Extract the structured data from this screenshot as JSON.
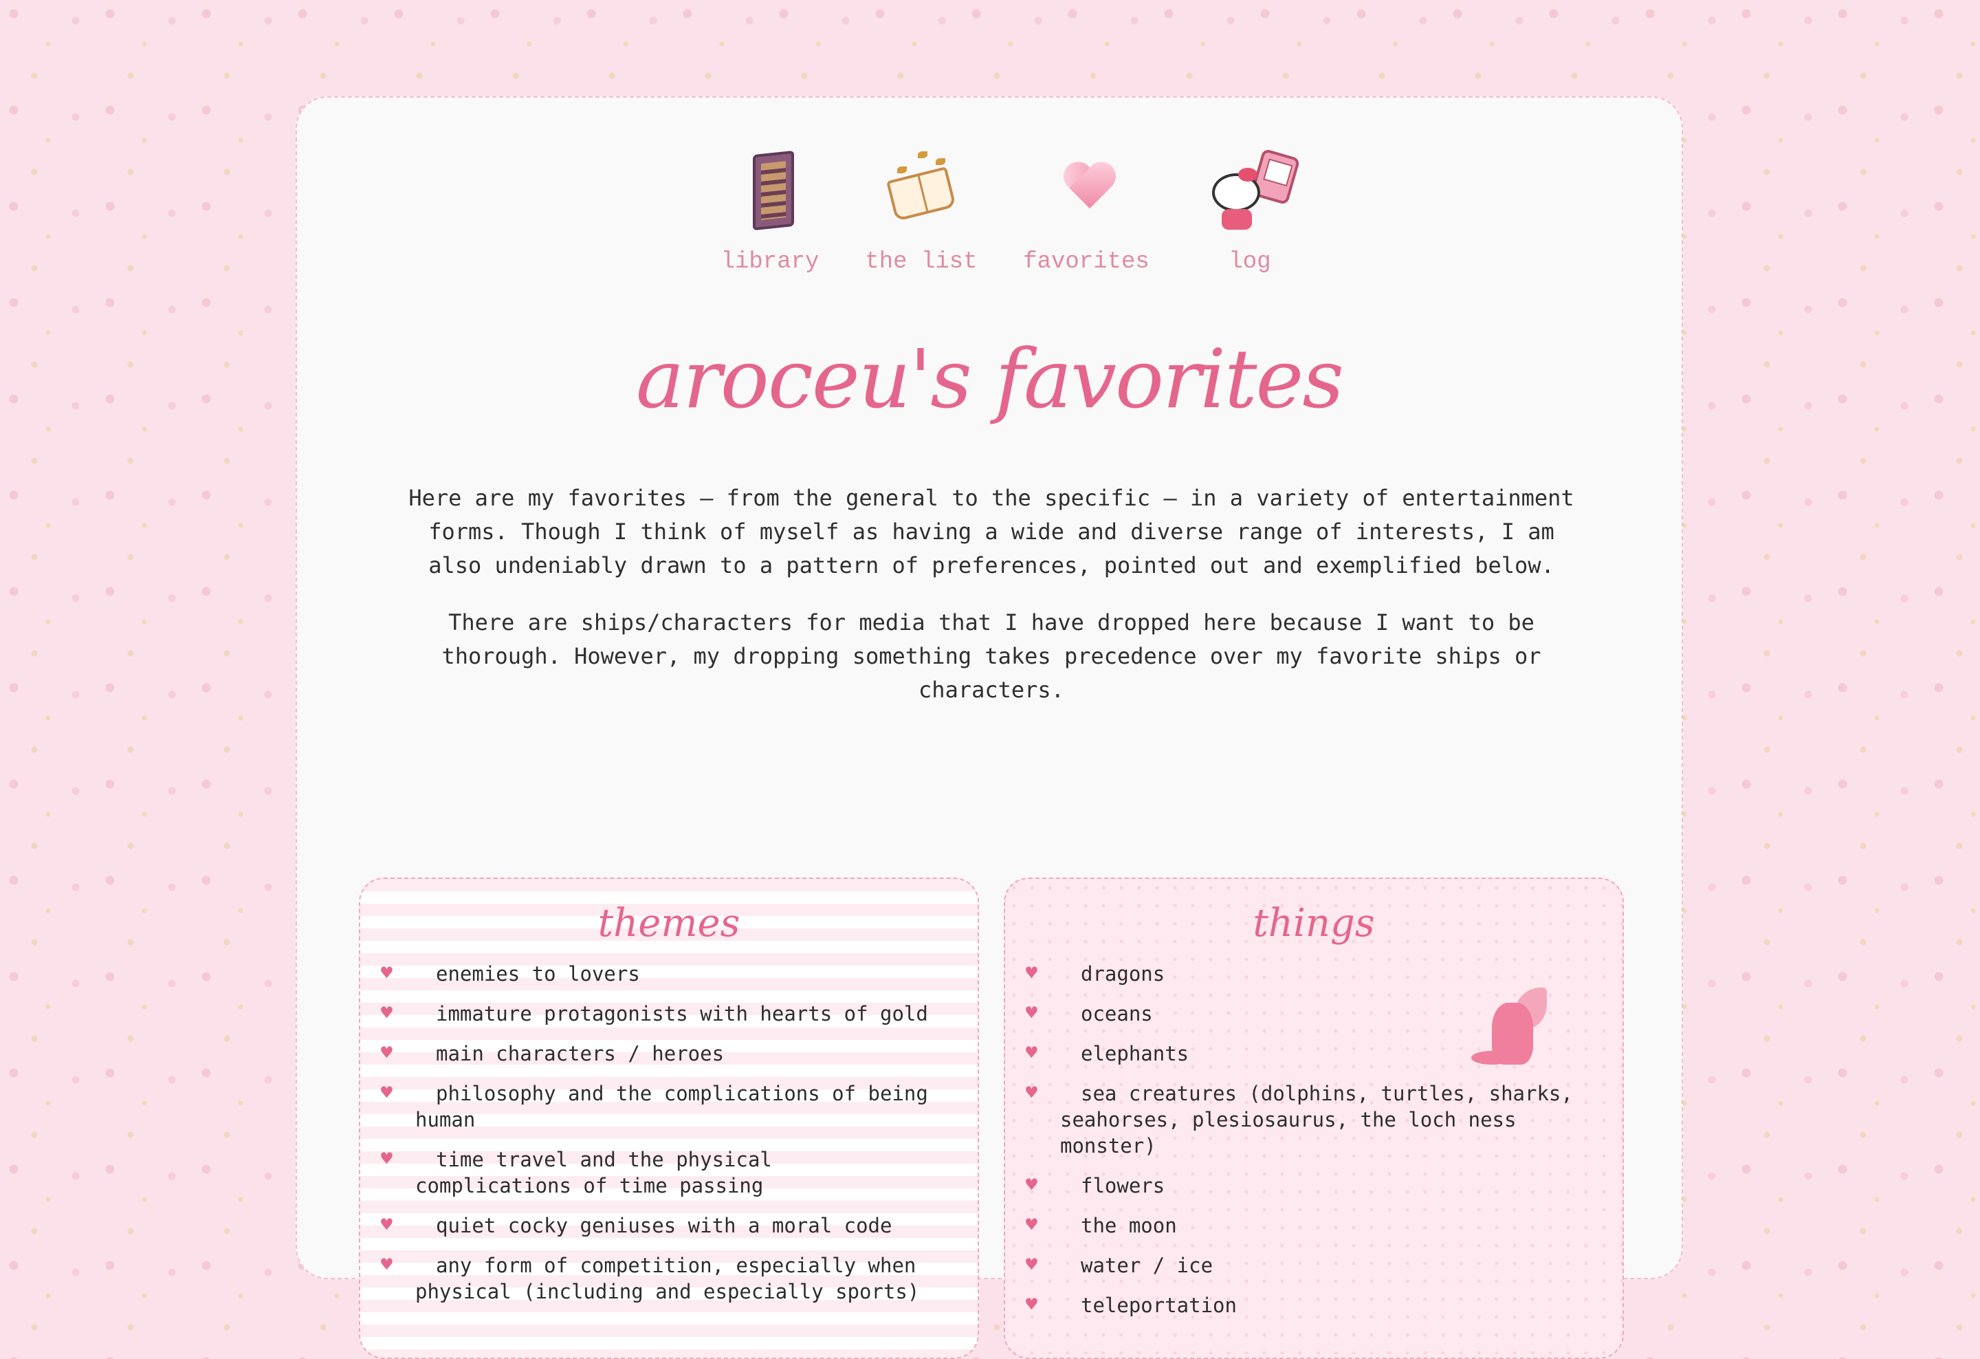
{
  "nav": {
    "items": [
      {
        "label": "library",
        "icon": "bookshelf-icon"
      },
      {
        "label": "the list",
        "icon": "open-book-icon"
      },
      {
        "label": "favorites",
        "icon": "heart-icon"
      },
      {
        "label": "log",
        "icon": "hello-kitty-gameboy-icon"
      }
    ]
  },
  "page": {
    "title": "aroceu's favorites",
    "intro_1": "Here are my favorites — from the general to the specific — in a variety of entertainment forms. Though I think of myself as having a wide and diverse range of interests, I am also undeniably drawn to a pattern of preferences, pointed out and exemplified below.",
    "intro_2": "There are ships/characters for media that I have dropped here because I want to be thorough. However, my dropping something takes precedence over my favorite ships or characters."
  },
  "themes": {
    "title": "themes",
    "items": [
      "enemies to lovers",
      "immature protagonists with hearts of gold",
      "main characters / heroes",
      "philosophy and the complications of being human",
      "time travel and the physical complications of time passing",
      "quiet cocky geniuses with a moral code",
      "any form of competition, especially when physical (including and especially sports)"
    ]
  },
  "things": {
    "title": "things",
    "items": [
      "dragons",
      "oceans",
      "elephants",
      "sea creatures (dolphins, turtles, sharks, seahorses, plesiosaurus, the loch ness monster)",
      "flowers",
      "the moon",
      "water / ice",
      "teleportation"
    ]
  },
  "colors": {
    "accent": "#e5668c",
    "nav_label": "#e08aa2",
    "background": "#fbe2ea",
    "panel": "#f9f9f9"
  }
}
